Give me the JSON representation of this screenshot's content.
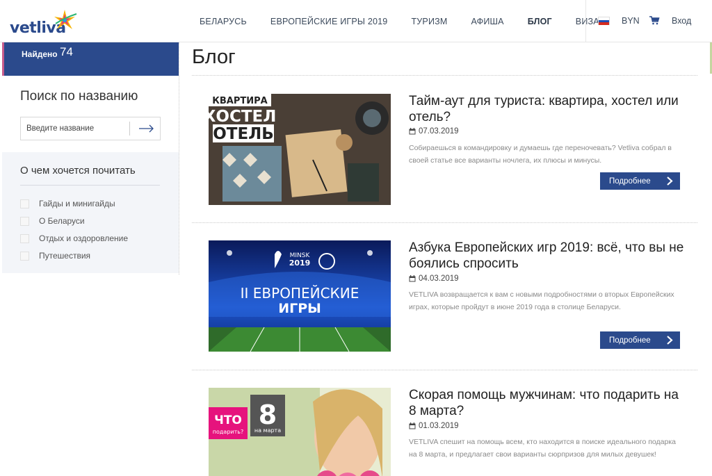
{
  "brand": {
    "logo_text": "vetliva"
  },
  "nav": {
    "items": [
      {
        "label": "Беларусь"
      },
      {
        "label": "Европейские игры 2019"
      },
      {
        "label": "Туризм"
      },
      {
        "label": "Афиша"
      },
      {
        "label": "Блог"
      },
      {
        "label": "Виза"
      }
    ],
    "active_index": 4,
    "currency": "BYN",
    "login": "Вход"
  },
  "sidebar": {
    "found_label": "Найдено",
    "found_count": "74",
    "search_title": "Поиск по названию",
    "search_placeholder": "Введите название",
    "categories_title": "О чем хочется почитать",
    "categories": [
      {
        "label": "Гайды и минигайды"
      },
      {
        "label": "О Беларуси"
      },
      {
        "label": "Отдых и оздоровление"
      },
      {
        "label": "Путешествия"
      }
    ]
  },
  "main": {
    "title": "Блог",
    "more_label": "Подробнее",
    "posts": [
      {
        "title": "Тайм-аут для туриста: квартира, хостел или отель?",
        "date": "07.03.2019",
        "excerpt": "Собираешься в командировку и думаешь где переночевать? Vetliva собрал в своей статье все варианты ночлега, их плюсы и минусы.",
        "image_text": [
          "КВАРТИРА",
          "ХОСТЕЛ",
          "ОТЕЛЬ"
        ]
      },
      {
        "title": "Азбука Европейских игр 2019: всё, что вы не боялись спросить",
        "date": "04.03.2019",
        "excerpt": "VETLIVA возвращается к вам с новыми подробностями о вторых Европейских играх, которые пройдут в июне 2019 года в столице Беларуси.",
        "image_text": [
          "MINSK",
          "2019",
          "II ЕВРОПЕЙСКИЕ",
          "ИГРЫ"
        ]
      },
      {
        "title": "Скорая помощь мужчинам: что подарить на 8 марта?",
        "date": "01.03.2019",
        "excerpt": "VETLIVA спешит на помощь всем, кто находится в поиске идеального подарка на 8 марта, и предлагает свои варианты сюрпризов для милых девушек!",
        "image_text": [
          "ЧТО",
          "подарить?",
          "8",
          "на марта"
        ]
      }
    ]
  },
  "colors": {
    "brand_blue": "#2b4a8c",
    "panel_bg": "#f3f5f9",
    "muted_text": "#8a8a8a"
  }
}
